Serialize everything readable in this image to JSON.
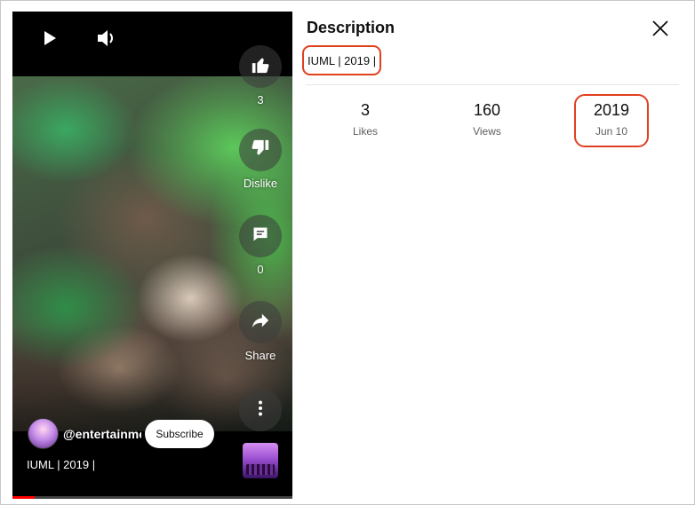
{
  "player": {
    "actions": {
      "likes_count": "3",
      "dislike_label": "Dislike",
      "comments_count": "0",
      "share_label": "Share"
    },
    "channel": {
      "handle": "@entertainme",
      "subscribe_label": "Subscribe"
    },
    "video_title": "IUML | 2019 |",
    "progress": 0.08,
    "icons": [
      "play-icon",
      "volume-icon",
      "thumbs-up-icon",
      "thumbs-down-icon",
      "comment-icon",
      "share-icon",
      "more-vert-icon"
    ]
  },
  "description_panel": {
    "title": "Description",
    "text": "IUML | 2019 |",
    "stats": {
      "likes_value": "3",
      "likes_label": "Likes",
      "views_value": "160",
      "views_label": "Views",
      "year_value": "2019",
      "date_label": "Jun 10"
    }
  },
  "colors": {
    "highlight_box": "#e0401f",
    "progress_red": "#ff0000",
    "player_bg": "#000000"
  }
}
